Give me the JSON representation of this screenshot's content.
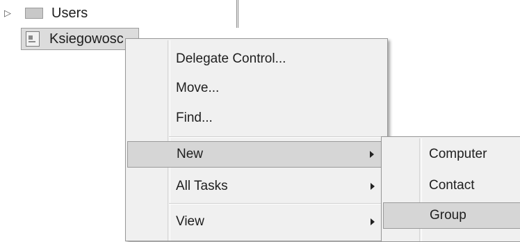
{
  "tree": {
    "items": [
      {
        "label": "Users",
        "icon": "folder-icon",
        "expander": "▷"
      },
      {
        "label": "Ksiegowosc",
        "icon": "organizational-unit-icon",
        "selected": true
      }
    ]
  },
  "context_menu": {
    "items": [
      {
        "label": "Delegate Control..."
      },
      {
        "label": "Move..."
      },
      {
        "label": "Find..."
      },
      {
        "label": "New",
        "has_submenu": true,
        "highlighted": true
      },
      {
        "label": "All Tasks",
        "has_submenu": true
      },
      {
        "label": "View",
        "has_submenu": true
      }
    ]
  },
  "submenu": {
    "items": [
      {
        "label": "Computer"
      },
      {
        "label": "Contact"
      },
      {
        "label": "Group",
        "highlighted": true
      }
    ]
  }
}
